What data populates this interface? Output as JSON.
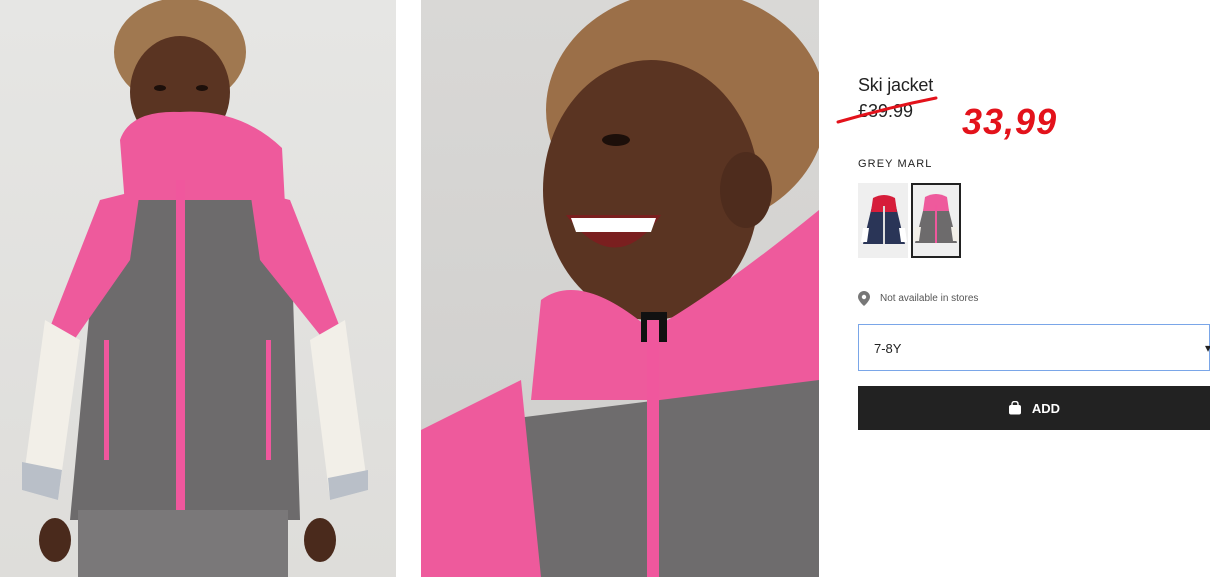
{
  "product": {
    "title": "Ski jacket",
    "old_price": "£39.99",
    "new_price": "33,99",
    "color_label": "GREY MARL",
    "swatches": [
      {
        "name": "navy-red",
        "selected": false
      },
      {
        "name": "grey-marl",
        "selected": true
      }
    ],
    "store_availability": "Not available in stores",
    "size_selected": "7-8Y",
    "add_button_label": "ADD"
  },
  "icons": {
    "location": "location-pin-icon",
    "bag": "shopping-bag-icon",
    "chevron": "chevron-down-icon"
  },
  "colors": {
    "sale_red": "#e3121b",
    "button_dark": "#222222",
    "jacket_pink": "#f0579d",
    "jacket_grey": "#6d6b6c"
  }
}
